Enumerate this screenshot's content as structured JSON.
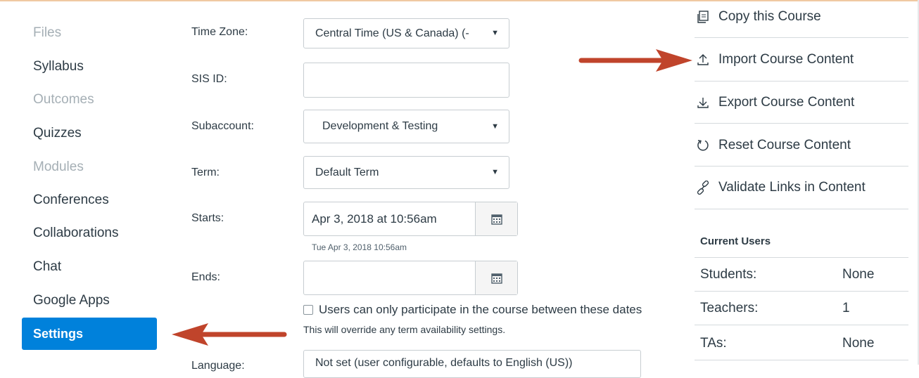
{
  "nav": {
    "items": [
      {
        "label": "Files",
        "state": "disabled"
      },
      {
        "label": "Syllabus",
        "state": "enabled"
      },
      {
        "label": "Outcomes",
        "state": "disabled"
      },
      {
        "label": "Quizzes",
        "state": "enabled"
      },
      {
        "label": "Modules",
        "state": "disabled"
      },
      {
        "label": "Conferences",
        "state": "enabled"
      },
      {
        "label": "Collaborations",
        "state": "enabled"
      },
      {
        "label": "Chat",
        "state": "enabled"
      },
      {
        "label": "Google Apps",
        "state": "enabled"
      }
    ],
    "active": "Settings",
    "active_color": "#0081db"
  },
  "form": {
    "time_zone": {
      "label": "Time Zone:",
      "value": "Central Time (US & Canada) (-"
    },
    "sis_id": {
      "label": "SIS ID:",
      "value": ""
    },
    "subaccount": {
      "label": "Subaccount:",
      "value": "Development & Testing"
    },
    "term": {
      "label": "Term:",
      "value": "Default Term"
    },
    "starts": {
      "label": "Starts:",
      "value": "Apr 3, 2018 at 10:56am",
      "hint": "Tue Apr 3, 2018 10:56am"
    },
    "ends": {
      "label": "Ends:",
      "value": ""
    },
    "restrict_dates": {
      "label": "Users can only participate in the course between these dates",
      "checked": false
    },
    "override_note": "This will override any term availability settings.",
    "language": {
      "label": "Language:",
      "value": "Not set (user configurable, defaults to English (US))"
    }
  },
  "sidebar": {
    "actions": [
      {
        "label": "Copy this Course",
        "icon": "copy-icon"
      },
      {
        "label": "Import Course Content",
        "icon": "import-icon"
      },
      {
        "label": "Export Course Content",
        "icon": "export-icon"
      },
      {
        "label": "Reset Course Content",
        "icon": "reset-icon"
      },
      {
        "label": "Validate Links in Content",
        "icon": "link-icon"
      }
    ],
    "current_users": {
      "title": "Current Users",
      "rows": [
        {
          "label": "Students:",
          "value": "None"
        },
        {
          "label": "Teachers:",
          "value": "1"
        },
        {
          "label": "TAs:",
          "value": "None"
        }
      ]
    }
  },
  "annotation_color": "#c0442b"
}
